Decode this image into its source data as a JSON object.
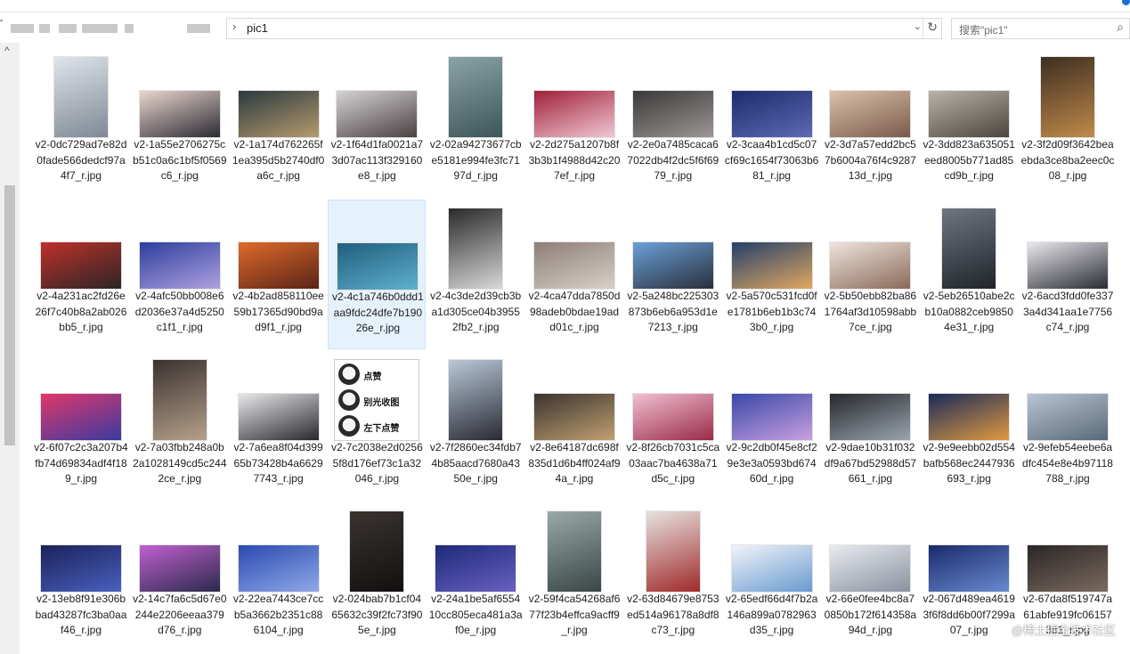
{
  "window": {
    "accent": "#1c6fd0"
  },
  "address_bar": {
    "folder": "pic1",
    "separator_glyph": "›",
    "dropdown_glyph": "⌄",
    "refresh_glyph": "↻"
  },
  "search": {
    "placeholder": "搜索\"pic1\"",
    "icon": "search-icon"
  },
  "scrollbar": {
    "up_glyph": "^"
  },
  "files": [
    {
      "name": "v2-0dc729ad7e82d0fade566dedcf97a4f7_r.jpg",
      "orient": "p",
      "c1": "#dfe4ea",
      "c2": "#7f8894"
    },
    {
      "name": "v2-1a55e2706275cb51c0a6c1bf5f0569c6_r.jpg",
      "orient": "l",
      "c1": "#e9d7cf",
      "c2": "#2c2a33"
    },
    {
      "name": "v2-1a174d762265f1ea395d5b2740df0a6c_r.jpg",
      "orient": "l",
      "c1": "#2b3a3e",
      "c2": "#b59a6e"
    },
    {
      "name": "v2-1f64d1fa0021a73d07ac113f329160e8_r.jpg",
      "orient": "l",
      "c1": "#d6d3d4",
      "c2": "#4a4142"
    },
    {
      "name": "v2-02a94273677cbe5181e994fe3fc7197d_r.jpg",
      "orient": "p",
      "c1": "#8aa3a6",
      "c2": "#3e5657"
    },
    {
      "name": "v2-2d275a1207b8f3b3b1f4988d42c207ef_r.jpg",
      "orient": "l",
      "c1": "#a0203a",
      "c2": "#f0c8d4"
    },
    {
      "name": "v2-2e0a7485caca67022db4f2dc5f6f6979_r.jpg",
      "orient": "l",
      "c1": "#3a3838",
      "c2": "#9c9796"
    },
    {
      "name": "v2-3caa4b1cd5c07cf69c1654f73063b681_r.jpg",
      "orient": "l",
      "c1": "#1d2c6a",
      "c2": "#5c6ab4"
    },
    {
      "name": "v2-3d7a57edd2bc57b6004a76f4c928713d_r.jpg",
      "orient": "l",
      "c1": "#d9c2ab",
      "c2": "#7a5a4a"
    },
    {
      "name": "v2-3dd823a635051eed8005b771ad85cd9b_r.jpg",
      "orient": "l",
      "c1": "#b8b3a8",
      "c2": "#4a463f"
    },
    {
      "name": "v2-3f2d09f3642beaebda3ce8ba2eec0c08_r.jpg",
      "orient": "p",
      "c1": "#3c2e22",
      "c2": "#c08a4a"
    },
    {
      "name": "v2-4a231ac2fd26e26f7c40b8a2ab026bb5_r.jpg",
      "orient": "l",
      "c1": "#c0302a",
      "c2": "#2a2626"
    },
    {
      "name": "v2-4afc50bb008e6d2036e37a4d5250c1f1_r.jpg",
      "orient": "l",
      "c1": "#2b3f9c",
      "c2": "#b0a0e0"
    },
    {
      "name": "v2-4b2ad858110ee59b17365d90bd9ad9f1_r.jpg",
      "orient": "l",
      "c1": "#e06a2a",
      "c2": "#5a2418"
    },
    {
      "name": "v2-4c1a746b0ddd1aa9fdc24dfe7b19026e_r.jpg",
      "orient": "l",
      "c1": "#1f5e7c",
      "c2": "#5fb0d0"
    },
    {
      "name": "v2-4c3de2d39cb3ba1d305ce04b39552fb2_r.jpg",
      "orient": "p",
      "c1": "#2a2a2a",
      "c2": "#d8d8d8"
    },
    {
      "name": "v2-4ca47dda7850d98adeb0bdae19add01c_r.jpg",
      "orient": "l",
      "c1": "#8c7e78",
      "c2": "#d9d0c9"
    },
    {
      "name": "v2-5a248bc225303873b6eb6a953d1e7213_r.jpg",
      "orient": "l",
      "c1": "#6aa0d8",
      "c2": "#2a2f3a"
    },
    {
      "name": "v2-5a570c531fcd0fe1781b6eb1b3c743b0_r.jpg",
      "orient": "l",
      "c1": "#24406a",
      "c2": "#e0a860"
    },
    {
      "name": "v2-5b50ebb82ba861764af3d10598abb7ce_r.jpg",
      "orient": "l",
      "c1": "#efe4dc",
      "c2": "#8a6a5a"
    },
    {
      "name": "v2-5eb26510abe2cb10a0882ceb98504e31_r.jpg",
      "orient": "p",
      "c1": "#6e7680",
      "c2": "#20242a"
    },
    {
      "name": "v2-6acd3fdd0fe3373a4d341aa1e7756c74_r.jpg",
      "orient": "l",
      "c1": "#e8e8ec",
      "c2": "#2a2c34"
    },
    {
      "name": "v2-6f07c2c3a207b4fb74d69834adf4f189_r.jpg",
      "orient": "l",
      "c1": "#e0386a",
      "c2": "#3a3aa0"
    },
    {
      "name": "v2-7a03fbb248a0b2a1028149cd5c2442ce_r.jpg",
      "orient": "p",
      "c1": "#3a3230",
      "c2": "#b6a08a"
    },
    {
      "name": "v2-7a6ea8f04d39965b73428b4a66297743_r.jpg",
      "orient": "l",
      "c1": "#e8e8ea",
      "c2": "#28282e"
    },
    {
      "name": "v2-7c2038e2d02565f8d176ef73c1a32046_r.jpg",
      "orient": "meme",
      "c1": "#ffffff",
      "c2": "#222222"
    },
    {
      "name": "v2-7f2860ec34fdb74b85aacd7680a4350e_r.jpg",
      "orient": "p",
      "c1": "#b8c8d8",
      "c2": "#2a2a34"
    },
    {
      "name": "v2-8e64187dc698f835d1d6b4ff024af94a_r.jpg",
      "orient": "l",
      "c1": "#3a3430",
      "c2": "#c0a070"
    },
    {
      "name": "v2-8f26cb7031c5ca03aac7ba4638a71d5c_r.jpg",
      "orient": "l",
      "c1": "#f0c0d0",
      "c2": "#9a2a4a"
    },
    {
      "name": "v2-9c2db0f45e8cf29e3e3a0593bd67460d_r.jpg",
      "orient": "l",
      "c1": "#3a48a8",
      "c2": "#c8a0e0"
    },
    {
      "name": "v2-9dae10b31f032df9a67bd52988d57661_r.jpg",
      "orient": "l",
      "c1": "#26282c",
      "c2": "#9aa4ae"
    },
    {
      "name": "v2-9e9eebb02d554bafb568ec2447936693_r.jpg",
      "orient": "l",
      "c1": "#1a2a5a",
      "c2": "#e09a40"
    },
    {
      "name": "v2-9efeb54eebe6adfc454e8e4b97118788_r.jpg",
      "orient": "l",
      "c1": "#b8c4d0",
      "c2": "#5a6a7a"
    },
    {
      "name": "v2-13eb8f91e306bbad43287fc3ba0aaf46_r.jpg",
      "orient": "l",
      "c1": "#1a2258",
      "c2": "#4a60c0"
    },
    {
      "name": "v2-14c7fa6c5d67e0244e2206eeaa379d76_r.jpg",
      "orient": "l",
      "c1": "#c060d0",
      "c2": "#2a2a4a"
    },
    {
      "name": "v2-22ea7443ce7ccb5a3662b2351c886104_r.jpg",
      "orient": "l",
      "c1": "#2a4ab0",
      "c2": "#90a8e8"
    },
    {
      "name": "v2-024bab7b1cf0465632c39f2fc73f905e_r.jpg",
      "orient": "p",
      "c1": "#3a3430",
      "c2": "#121010"
    },
    {
      "name": "v2-24a1be5af655410cc805eca481a3af0e_r.jpg",
      "orient": "l",
      "c1": "#1c2a7a",
      "c2": "#6a60c0"
    },
    {
      "name": "v2-59f4ca54268af677f23b4effca9acff9_r.jpg",
      "orient": "p",
      "c1": "#9aa8a8",
      "c2": "#3a4646"
    },
    {
      "name": "v2-63d84679e8753ed514a96178a8df8c73_r.jpg",
      "orient": "p",
      "c1": "#e6e2e0",
      "c2": "#a02a2a"
    },
    {
      "name": "v2-65edf66d4f7b2a146a899a0782963d35_r.jpg",
      "orient": "l",
      "c1": "#f0f4f8",
      "c2": "#6a9ad0"
    },
    {
      "name": "v2-66e0fee4bc8a70850b172f614358a94d_r.jpg",
      "orient": "l",
      "c1": "#e8eaee",
      "c2": "#8a92a0"
    },
    {
      "name": "v2-067d489ea46193f6f8dd6b00f7299a07_r.jpg",
      "orient": "l",
      "c1": "#1a2a6a",
      "c2": "#6a8ad0"
    },
    {
      "name": "v2-67da8f519747a61abfe919fc061573d1_r.jpg",
      "orient": "l",
      "c1": "#2a2626",
      "c2": "#7a6a60"
    }
  ],
  "selected_index": 14,
  "meme_labels": [
    "点赞",
    "别光收图",
    "左下点赞"
  ],
  "watermark": "@稀土掘金技术社区"
}
